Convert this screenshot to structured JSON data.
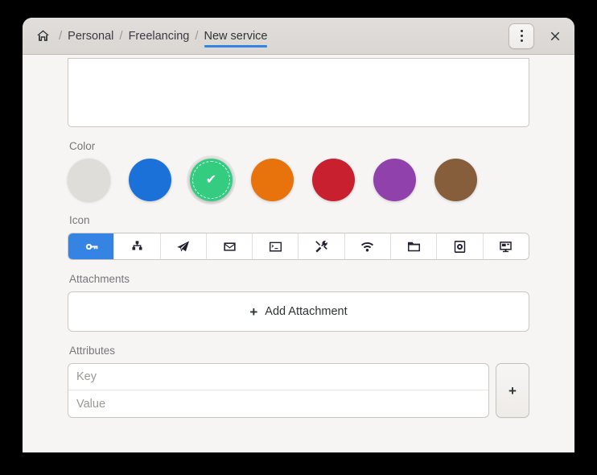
{
  "window": {
    "title": "New service",
    "bg": "#f6f5f4",
    "accent": "#3584e4"
  },
  "header": {
    "home_icon": "home-icon",
    "separator": "/",
    "crumbs": [
      {
        "label": "Personal",
        "current": false
      },
      {
        "label": "Freelancing",
        "current": false
      },
      {
        "label": "New service",
        "current": true
      }
    ],
    "menu_icon": "overflow-menu-icon",
    "close_icon": "close-icon",
    "close_glyph": "✕"
  },
  "form": {
    "description": {
      "name": "description-textarea",
      "value": ""
    },
    "color": {
      "label": "Color",
      "selected_index": 2,
      "check_glyph": "✔",
      "swatches": [
        {
          "name": "color-swatch-light",
          "hex": "#deddd9"
        },
        {
          "name": "color-swatch-blue",
          "hex": "#1c71d8"
        },
        {
          "name": "color-swatch-green",
          "hex": "#33cc80"
        },
        {
          "name": "color-swatch-orange",
          "hex": "#e8730c"
        },
        {
          "name": "color-swatch-red",
          "hex": "#c8202e"
        },
        {
          "name": "color-swatch-purple",
          "hex": "#9141ac"
        },
        {
          "name": "color-swatch-brown",
          "hex": "#865e3c"
        }
      ]
    },
    "icon": {
      "label": "Icon",
      "selected_index": 0,
      "items": [
        {
          "name": "key-icon"
        },
        {
          "name": "network-hierarchy-icon"
        },
        {
          "name": "paper-plane-icon"
        },
        {
          "name": "mail-icon"
        },
        {
          "name": "terminal-icon"
        },
        {
          "name": "tools-icon"
        },
        {
          "name": "wifi-icon"
        },
        {
          "name": "folder-icon"
        },
        {
          "name": "drive-icon"
        },
        {
          "name": "remote-desktop-icon"
        }
      ]
    },
    "attachments": {
      "label": "Attachments",
      "add_label": "Add Attachment",
      "plus_glyph": "+"
    },
    "attributes": {
      "label": "Attributes",
      "key_placeholder": "Key",
      "key_value": "",
      "value_placeholder": "Value",
      "value_value": "",
      "add_glyph": "+"
    }
  }
}
